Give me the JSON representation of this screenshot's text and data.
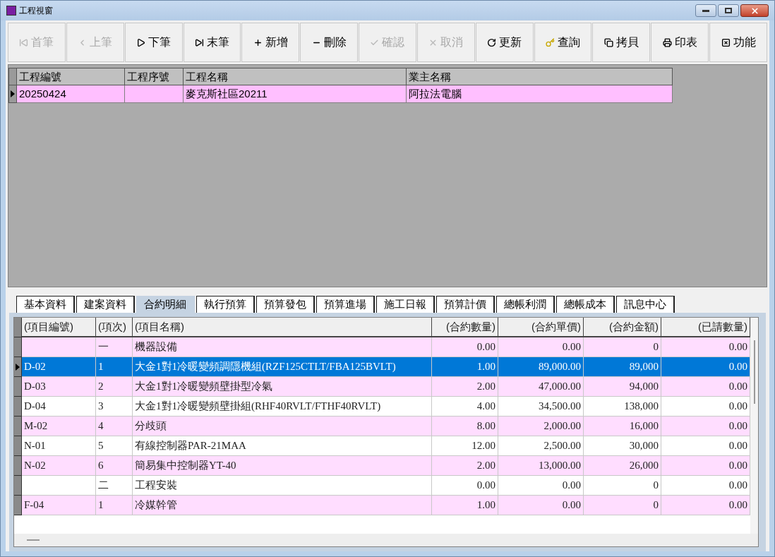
{
  "window": {
    "title": "工程視窗"
  },
  "toolbar": [
    {
      "label": "首筆",
      "kind": "first",
      "disabled": true
    },
    {
      "label": "上筆",
      "kind": "prev",
      "disabled": true
    },
    {
      "label": "下筆",
      "kind": "next",
      "disabled": false
    },
    {
      "label": "末筆",
      "kind": "last",
      "disabled": false
    },
    {
      "label": "新增",
      "kind": "add",
      "disabled": false
    },
    {
      "label": "刪除",
      "kind": "delete",
      "disabled": false
    },
    {
      "label": "確認",
      "kind": "confirm",
      "disabled": true
    },
    {
      "label": "取消",
      "kind": "cancel",
      "disabled": true
    },
    {
      "label": "更新",
      "kind": "refresh",
      "disabled": false
    },
    {
      "label": "查詢",
      "kind": "query",
      "disabled": false
    },
    {
      "label": "拷貝",
      "kind": "copy",
      "disabled": false
    },
    {
      "label": "印表",
      "kind": "print",
      "disabled": false
    },
    {
      "label": "功能",
      "kind": "function",
      "disabled": false
    }
  ],
  "project_table": {
    "columns": [
      "工程編號",
      "工程序號",
      "工程名稱",
      "業主名稱"
    ],
    "rows": [
      {
        "cells": [
          "20250424",
          "",
          "麥克斯社區20211",
          "阿拉法電腦"
        ],
        "selected": true
      }
    ]
  },
  "tabs": [
    {
      "label": "基本資料",
      "selected": false
    },
    {
      "label": "建案資料",
      "selected": false
    },
    {
      "label": "合約明細",
      "selected": true
    },
    {
      "label": "執行預算",
      "selected": false
    },
    {
      "label": "預算發包",
      "selected": false
    },
    {
      "label": "預算進場",
      "selected": false
    },
    {
      "label": "施工日報",
      "selected": false
    },
    {
      "label": "預算計價",
      "selected": false
    },
    {
      "label": "總帳利潤",
      "selected": false
    },
    {
      "label": "總帳成本",
      "selected": false
    },
    {
      "label": "訊息中心",
      "selected": false
    }
  ],
  "detail_table": {
    "columns": [
      "(項目編號)",
      "(項次)",
      "(項目名稱)",
      "(合約數量)",
      "(合約單價)",
      "(合約金額)",
      "(已請數量)"
    ],
    "rows": [
      {
        "cells": [
          "",
          "一",
          "機器設備",
          "0.00",
          "0.00",
          "0",
          "0.00"
        ],
        "selected": false
      },
      {
        "cells": [
          "D-02",
          "1",
          "大金1對1冷暖變頻調隱機組(RZF125CTLT/FBA125BVLT)",
          "1.00",
          "89,000.00",
          "89,000",
          "0.00"
        ],
        "selected": true
      },
      {
        "cells": [
          "D-03",
          "2",
          "大金1對1冷暖變頻壁掛型冷氣",
          "2.00",
          "47,000.00",
          "94,000",
          "0.00"
        ],
        "selected": false
      },
      {
        "cells": [
          "D-04",
          "3",
          "大金1對1冷暖變頻壁掛組(RHF40RVLT/FTHF40RVLT)",
          "4.00",
          "34,500.00",
          "138,000",
          "0.00"
        ],
        "selected": false
      },
      {
        "cells": [
          "M-02",
          "4",
          "分歧頭",
          "8.00",
          "2,000.00",
          "16,000",
          "0.00"
        ],
        "selected": false
      },
      {
        "cells": [
          "N-01",
          "5",
          "有線控制器PAR-21MAA",
          "12.00",
          "2,500.00",
          "30,000",
          "0.00"
        ],
        "selected": false
      },
      {
        "cells": [
          "N-02",
          "6",
          "簡易集中控制器YT-40",
          "2.00",
          "13,000.00",
          "26,000",
          "0.00"
        ],
        "selected": false
      },
      {
        "cells": [
          "",
          "二",
          "工程安裝",
          "0.00",
          "0.00",
          "0",
          "0.00"
        ],
        "selected": false
      },
      {
        "cells": [
          "F-04",
          "1",
          "冷媒幹管",
          "1.00",
          "0.00",
          "0",
          "0.00"
        ],
        "selected": false
      }
    ]
  }
}
